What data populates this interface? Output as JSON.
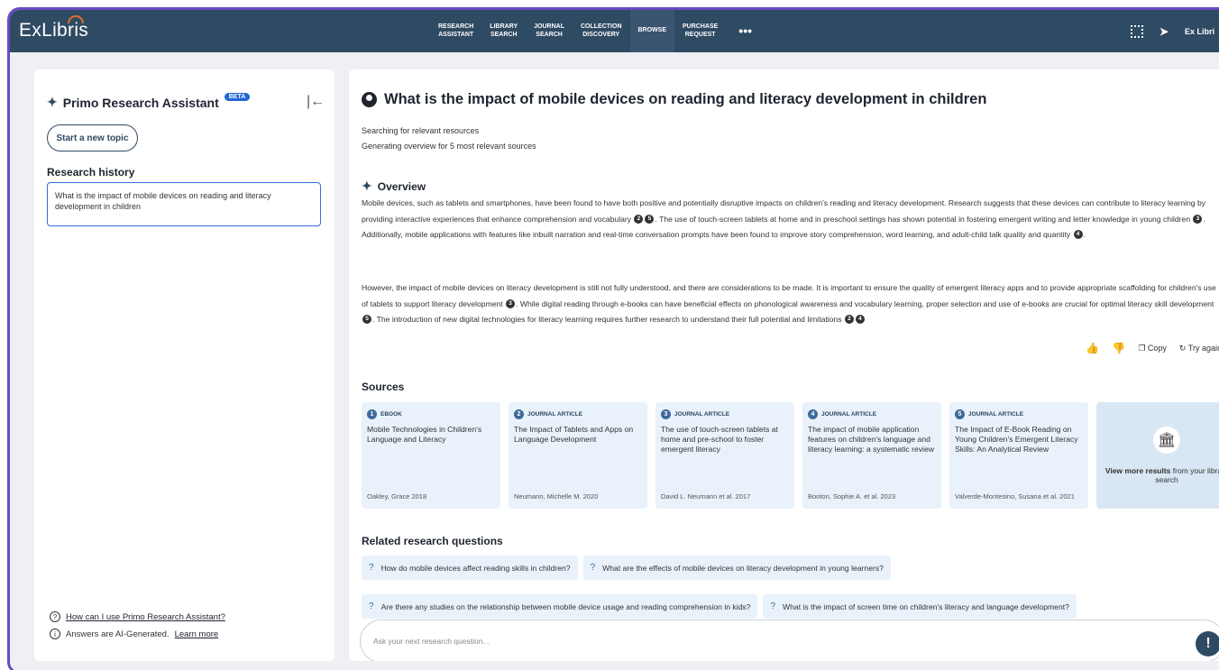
{
  "header": {
    "logo": "ExLibris",
    "nav": [
      "RESEARCH\nASSISTANT",
      "LIBRARY\nSEARCH",
      "JOURNAL\nSEARCH",
      "COLLECTION\nDISCOVERY",
      "BROWSE",
      "PURCHASE\nREQUEST",
      "•••"
    ],
    "user": "Ex Libri"
  },
  "sidebar": {
    "title": "Primo Research Assistant",
    "beta": "BETA",
    "new_topic": "Start a new topic",
    "history_title": "Research history",
    "history_item": "What is the impact of mobile devices on reading and literacy development in children",
    "help_link": "How can I use Primo Research Assistant?",
    "ai_note": "Answers are AI-Generated.",
    "learn_more": "Learn more"
  },
  "main": {
    "question": "What is the impact of mobile devices on reading and literacy development in children",
    "status1": "Searching for relevant resources",
    "status2": "Generating overview for 5 most relevant sources",
    "overview_title": "Overview",
    "p1": {
      "a": "Mobile devices, such as tablets and smartphones, have been found to have both positive and potentially disruptive impacts on children's reading and literacy development. Research suggests that these devices can contribute to literacy learning by providing interactive experiences that enhance comprehension and vocabulary",
      "b": ". The use of touch-screen tablets at home and in preschool settings has shown potential in fostering emergent writing and letter knowledge in young children",
      "c": ". Additionally, mobile applications with features like inbuilt narration and real-time conversation prompts have been found to improve story comprehension, word learning, and adult-child talk quality and quantity",
      "d": "."
    },
    "p2": {
      "a": "However, the impact of mobile devices on literacy development is still not fully understood, and there are considerations to be made. It is important to ensure the quality of emergent literacy apps and to provide appropriate scaffolding for children's use of tablets to support literacy development",
      "b": ". While digital reading through e-books can have beneficial effects on phonological awareness and vocabulary learning, proper selection and use of e-books are crucial for optimal literacy skill development",
      "c": ". The introduction of new digital technologies for literacy learning requires further research to understand their full potential and limitations"
    },
    "cites": [
      "2",
      "5",
      "3",
      "4",
      "3",
      "5",
      "2",
      "4"
    ],
    "copy": "Copy",
    "try_again": "Try again",
    "sources_title": "Sources",
    "sources": [
      {
        "num": "1",
        "type": "EBOOK",
        "title": "Mobile Technologies in Children's Language and Literacy",
        "author": "Oakley, Grace 2018"
      },
      {
        "num": "2",
        "type": "JOURNAL ARTICLE",
        "title": "The Impact of Tablets and Apps on Language Development",
        "author": "Neumann, Michelle M. 2020"
      },
      {
        "num": "3",
        "type": "JOURNAL ARTICLE",
        "title": "The use of touch-screen tablets at home and pre-school to foster emergent literacy",
        "author": "David L. Neumann et al. 2017"
      },
      {
        "num": "4",
        "type": "JOURNAL ARTICLE",
        "title": "The impact of mobile application features on children's language and literacy learning: a systematic review",
        "author": "Booton, Sophie A. et al. 2023"
      },
      {
        "num": "5",
        "type": "JOURNAL ARTICLE",
        "title": "The Impact of E-Book Reading on Young Children's Emergent Literacy Skills: An Analytical Review",
        "author": "Valverde-Montesino, Susana et al. 2021"
      }
    ],
    "view_more_bold": "View more results",
    "view_more_rest": " from your library search",
    "related_title": "Related research questions",
    "related": [
      "How do mobile devices affect reading skills in children?",
      "What are the effects of mobile devices on literacy development in young learners?",
      "Are there any studies on the relationship between mobile device usage and reading comprehension in kids?",
      "What is the impact of screen time on children's literacy and language development?"
    ],
    "ask_placeholder": "Ask your next research question..."
  }
}
